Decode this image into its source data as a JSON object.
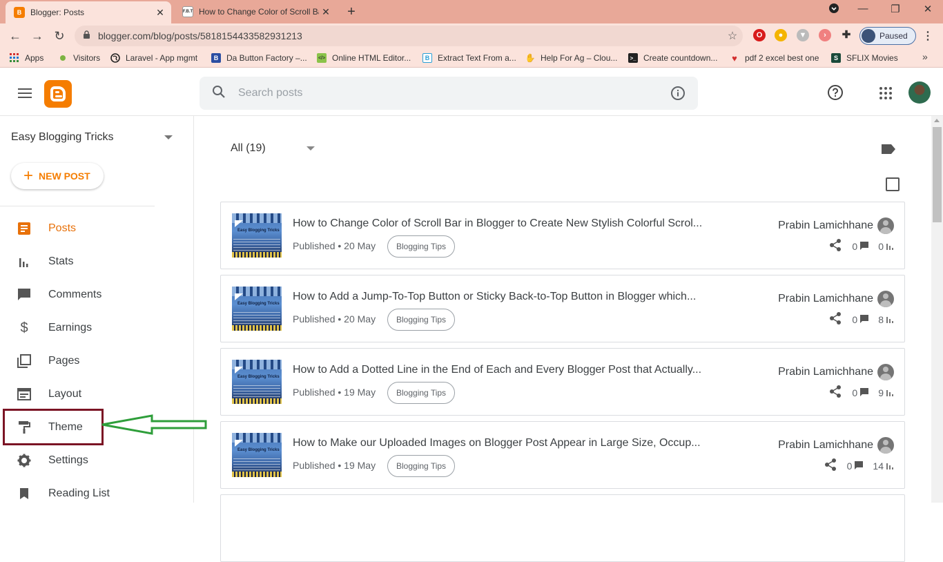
{
  "browser": {
    "tabs": [
      {
        "title": "Blogger: Posts",
        "favicon": "blogger-icon",
        "active": true
      },
      {
        "title": "How to Change Color of Scroll Ba",
        "favicon": "site-icon",
        "active": false
      }
    ],
    "url": "blogger.com/blog/posts/5818154433582931213",
    "profile_status": "Paused",
    "bookmarks": [
      {
        "label": "Apps",
        "icon": "apps-grid-icon"
      },
      {
        "label": "Visitors",
        "icon": "dot-icon"
      },
      {
        "label": "Laravel - App mgmt",
        "icon": "globe-icon"
      },
      {
        "label": "Da Button Factory –...",
        "icon": "button-factory-icon"
      },
      {
        "label": "Online HTML Editor...",
        "icon": "code-icon"
      },
      {
        "label": "Extract Text From a...",
        "icon": "text-icon"
      },
      {
        "label": "Help For Ag – Clou...",
        "icon": "hand-icon"
      },
      {
        "label": "Create countdown...",
        "icon": "terminal-icon"
      },
      {
        "label": "pdf 2 excel best one",
        "icon": "heart-icon"
      },
      {
        "label": "SFLIX Movies",
        "icon": "sflix-icon"
      }
    ],
    "more_bookmarks": "»"
  },
  "header": {
    "search_placeholder": "Search posts"
  },
  "sidebar": {
    "blog_name": "Easy Blogging Tricks",
    "new_post": "NEW POST",
    "items": [
      {
        "label": "Posts",
        "icon": "posts-icon",
        "active": true
      },
      {
        "label": "Stats",
        "icon": "stats-icon",
        "active": false
      },
      {
        "label": "Comments",
        "icon": "comments-icon",
        "active": false
      },
      {
        "label": "Earnings",
        "icon": "dollar-icon",
        "active": false
      },
      {
        "label": "Pages",
        "icon": "pages-icon",
        "active": false
      },
      {
        "label": "Layout",
        "icon": "layout-icon",
        "active": false
      },
      {
        "label": "Theme",
        "icon": "paint-roller-icon",
        "active": false
      },
      {
        "label": "Settings",
        "icon": "gear-icon",
        "active": false
      },
      {
        "label": "Reading List",
        "icon": "bookmark-icon",
        "active": false
      }
    ]
  },
  "main": {
    "filter": "All (19)",
    "posts": [
      {
        "title": "How to Change Color of Scroll Bar in Blogger to Create New Stylish Colorful Scrol...",
        "status": "Published • 20 May",
        "label": "Blogging Tips",
        "author": "Prabin Lamichhane",
        "comments": "0",
        "views": "0"
      },
      {
        "title": "How to Add a Jump-To-Top Button or Sticky Back-to-Top Button in Blogger which...",
        "status": "Published • 20 May",
        "label": "Blogging Tips",
        "author": "Prabin Lamichhane",
        "comments": "0",
        "views": "8"
      },
      {
        "title": "How to Add a Dotted Line in the End of Each and Every Blogger Post that Actually...",
        "status": "Published • 19 May",
        "label": "Blogging Tips",
        "author": "Prabin Lamichhane",
        "comments": "0",
        "views": "9"
      },
      {
        "title": "How to Make our Uploaded Images on Blogger Post Appear in Large Size, Occup...",
        "status": "Published • 19 May",
        "label": "Blogging Tips",
        "author": "Prabin Lamichhane",
        "comments": "0",
        "views": "14"
      }
    ],
    "thumbnail_text": "Easy Blogging Tricks"
  },
  "colors": {
    "accent": "#f57d00",
    "active_nav": "#e8710a",
    "highlight_box": "#7b1424",
    "arrow": "#2e9e3a",
    "tab_strip": "#e8a898"
  }
}
